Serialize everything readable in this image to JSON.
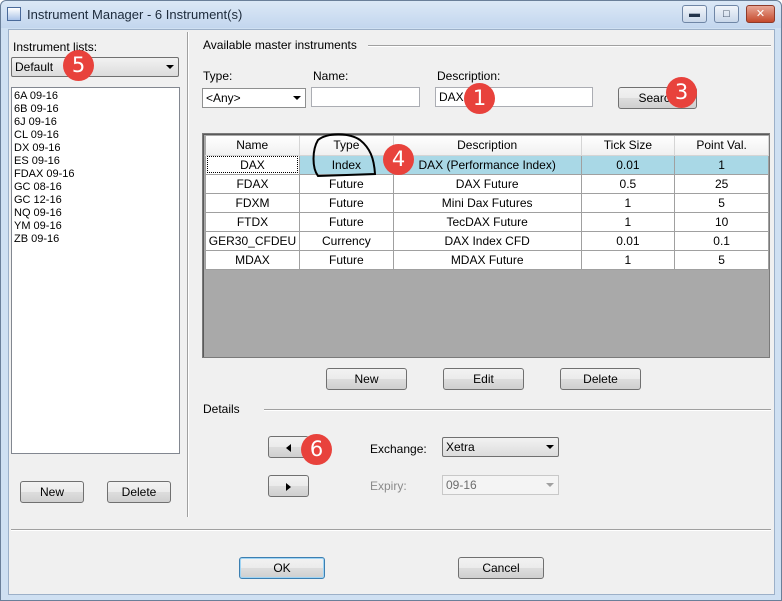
{
  "window": {
    "title": "Instrument Manager - 6 Instrument(s)",
    "controls": {
      "minimize": "▬",
      "maximize": "□",
      "close": "✕"
    }
  },
  "left_panel": {
    "lists_label": "Instrument lists:",
    "selected_list": "Default",
    "instruments": [
      "6A 09-16",
      "6B 09-16",
      "6J 09-16",
      "CL 09-16",
      "DX 09-16",
      "ES 09-16",
      "FDAX 09-16",
      "GC 08-16",
      "GC 12-16",
      "NQ 09-16",
      "YM 09-16",
      "ZB 09-16"
    ],
    "new_label": "New",
    "delete_label": "Delete"
  },
  "master": {
    "section_label": "Available master instruments",
    "type_label": "Type:",
    "type_value": "<Any>",
    "name_label": "Name:",
    "name_value": "",
    "description_label": "Description:",
    "description_value": "DAX",
    "search_label": "Search"
  },
  "grid": {
    "columns": [
      "Name",
      "Type",
      "Description",
      "Tick Size",
      "Point Val."
    ],
    "rows": [
      [
        "DAX",
        "Index",
        "DAX (Performance Index)",
        "0.01",
        "1"
      ],
      [
        "FDAX",
        "Future",
        "DAX Future",
        "0.5",
        "25"
      ],
      [
        "FDXM",
        "Future",
        "Mini Dax Futures",
        "1",
        "5"
      ],
      [
        "FTDX",
        "Future",
        "TecDAX Future",
        "1",
        "10"
      ],
      [
        "GER30_CFDEU",
        "Currency",
        "DAX Index CFD",
        "0.01",
        "0.1"
      ],
      [
        "MDAX",
        "Future",
        "MDAX Future",
        "1",
        "5"
      ]
    ]
  },
  "grid_buttons": {
    "new": "New",
    "edit": "Edit",
    "delete": "Delete"
  },
  "details": {
    "section_label": "Details",
    "exchange_label": "Exchange:",
    "exchange_value": "Xetra",
    "expiry_label": "Expiry:",
    "expiry_value": "09-16"
  },
  "footer": {
    "ok_label": "OK",
    "cancel_label": "Cancel"
  },
  "annotations": {
    "m1": "1",
    "m3": "3",
    "m4": "4",
    "m5": "5",
    "m6": "6"
  },
  "colors": {
    "marker": "#e8423c",
    "selected_row": "#a9d8e6",
    "grid_background": "#a9a9a9"
  }
}
